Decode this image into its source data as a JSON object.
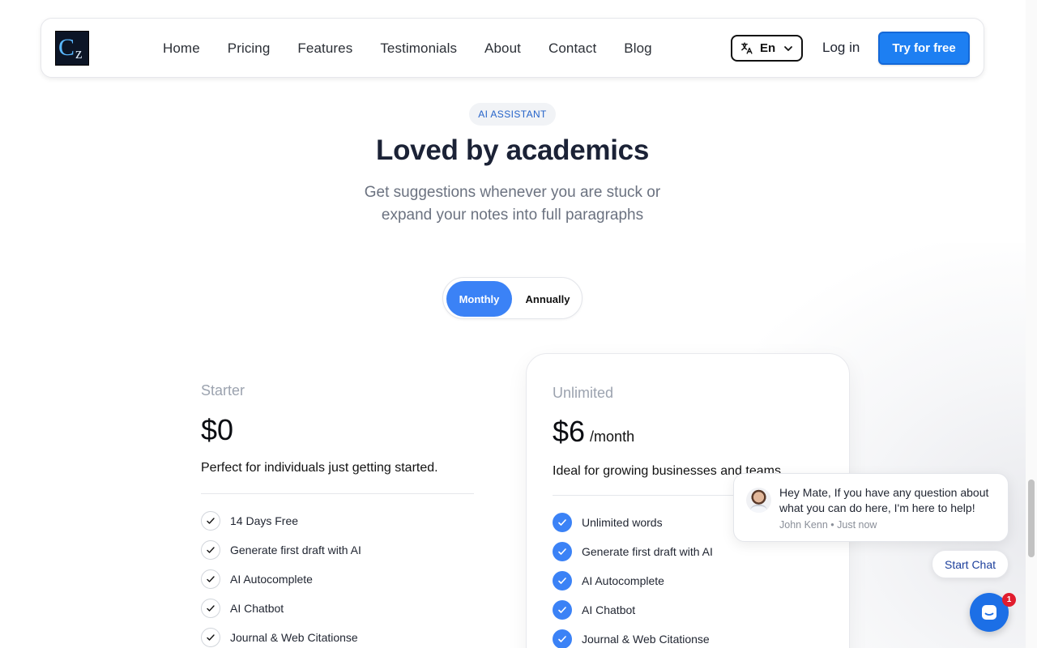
{
  "nav": {
    "logo_letter_main": "C",
    "logo_letter_sub": "z",
    "links": [
      "Home",
      "Pricing",
      "Features",
      "Testimonials",
      "About",
      "Contact",
      "Blog"
    ],
    "language": "En",
    "login": "Log in",
    "cta": "Try for free"
  },
  "hero": {
    "badge": "AI ASSISTANT",
    "title": "Loved by academics",
    "subtitle_line1": "Get suggestions whenever you are stuck or",
    "subtitle_line2": "expand your notes into full paragraphs"
  },
  "billing_toggle": {
    "monthly": "Monthly",
    "annually": "Annually",
    "selected": "Monthly"
  },
  "plans": {
    "starter": {
      "name": "Starter",
      "price": "$0",
      "description": "Perfect for individuals just getting started.",
      "features": [
        "14 Days Free",
        "Generate first draft with AI",
        "AI Autocomplete",
        "AI Chatbot",
        "Journal & Web Citationse"
      ]
    },
    "unlimited": {
      "name": "Unlimited",
      "price": "$6",
      "period": "/month",
      "description": "Ideal for growing businesses and teams.",
      "features": [
        "Unlimited words",
        "Generate first draft with AI",
        "AI Autocomplete",
        "AI Chatbot",
        "Journal & Web Citationse"
      ]
    }
  },
  "chat": {
    "message": "Hey Mate, If you have any question about what you can do here, I'm here to help!",
    "author": "John Kenn",
    "time": "Just now",
    "start_label": "Start Chat",
    "unread_count": "1"
  },
  "colors": {
    "accent": "#3b82f6",
    "cta": "#1d7ff2",
    "badge_text": "#2563c9",
    "notification": "#e11d2e"
  }
}
